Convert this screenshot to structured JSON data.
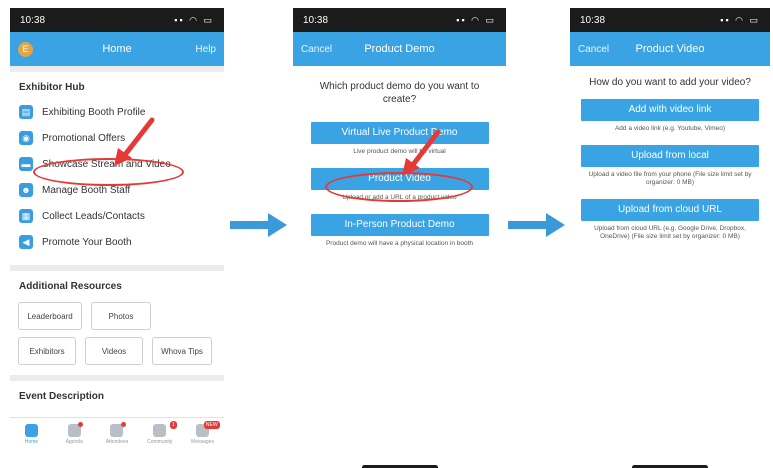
{
  "screen1": {
    "status_time": "10:38",
    "avatar_letter": "E",
    "nav_title": "Home",
    "nav_right": "Help",
    "exhibitor_hub_title": "Exhibitor Hub",
    "menu": [
      {
        "label": "Exhibiting Booth Profile",
        "icon": "id-card-icon"
      },
      {
        "label": "Promotional Offers",
        "icon": "tag-icon"
      },
      {
        "label": "Showcase Stream and Video",
        "icon": "video-icon"
      },
      {
        "label": "Manage Booth Staff",
        "icon": "people-icon"
      },
      {
        "label": "Collect Leads/Contacts",
        "icon": "grid-icon"
      },
      {
        "label": "Promote Your Booth",
        "icon": "megaphone-icon"
      }
    ],
    "additional_resources_title": "Additional Resources",
    "resources": [
      "Leaderboard",
      "Photos",
      "Exhibitors",
      "Videos",
      "Whova Tips"
    ],
    "event_description_title": "Event Description",
    "tabs": [
      "Home",
      "Agenda",
      "Attendees",
      "Community",
      "Messages"
    ],
    "messages_badge": "NEW",
    "community_badge": "1"
  },
  "screen2": {
    "status_time": "10:38",
    "nav_left": "Cancel",
    "nav_title": "Product Demo",
    "prompt": "Which product demo do you want to create?",
    "options": [
      {
        "label": "Virtual Live Product Demo",
        "helper": "Live product demo will be virtual"
      },
      {
        "label": "Product Video",
        "helper": "Upload or add a URL of a product video"
      },
      {
        "label": "In-Person Product Demo",
        "helper": "Product demo will have a physical location in booth"
      }
    ]
  },
  "screen3": {
    "status_time": "10:38",
    "nav_left": "Cancel",
    "nav_title": "Product Video",
    "prompt": "How do you want to add your video?",
    "options": [
      {
        "label": "Add with video link",
        "helper": "Add a video link (e.g. Youtube, Vimeo)"
      },
      {
        "label": "Upload from local",
        "helper": "Upload a video file from your phone (File size limit set by organizer: 0 MB)"
      },
      {
        "label": "Upload from cloud URL",
        "helper": "Upload from cloud URL (e.g. Google Drive, Dropbox, OneDrive) (File size limit set by organizer: 0 MB)"
      }
    ]
  },
  "colors": {
    "brand_blue": "#3aa3e3",
    "annotation_red": "#e53935",
    "flow_arrow": "#3a9ad9"
  }
}
